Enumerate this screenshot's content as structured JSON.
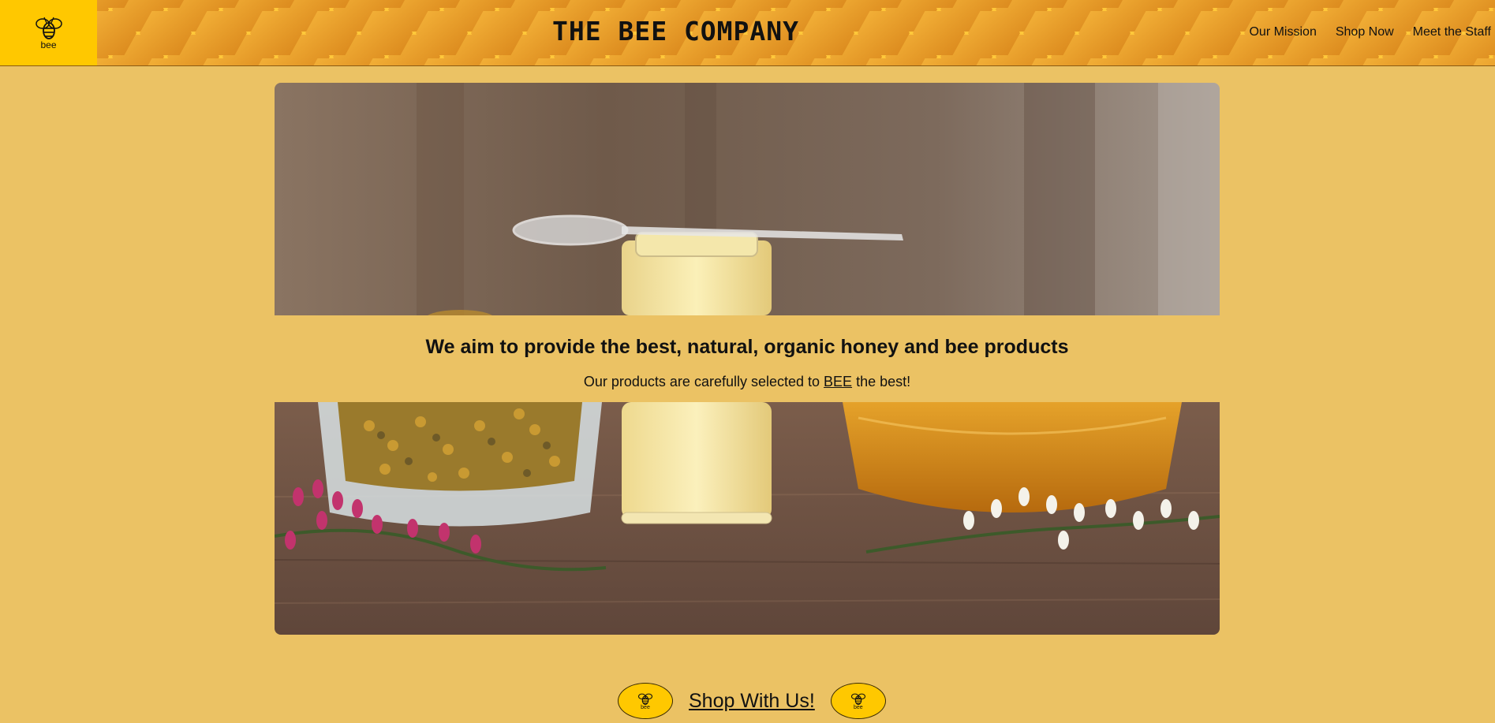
{
  "header": {
    "logo_text": "bee",
    "title": "THE BEE COMPANY",
    "nav": [
      {
        "label": "Our Mission"
      },
      {
        "label": "Shop Now"
      },
      {
        "label": "Meet the Staff"
      }
    ]
  },
  "hero": {
    "heading": "We aim to provide the best, natural, organic honey and bee products",
    "sub_before": "Our products are carefully selected to ",
    "sub_emph": "BEE",
    "sub_after": " the best!"
  },
  "shop": {
    "link_label": "Shop With Us!",
    "badge_text": "bee"
  },
  "colors": {
    "page_background": "#EBC264",
    "logo_background": "#FFC800",
    "honeycomb": "#E9A22E"
  },
  "icons": {
    "logo": "bee-icon",
    "badge": "bee-icon"
  }
}
